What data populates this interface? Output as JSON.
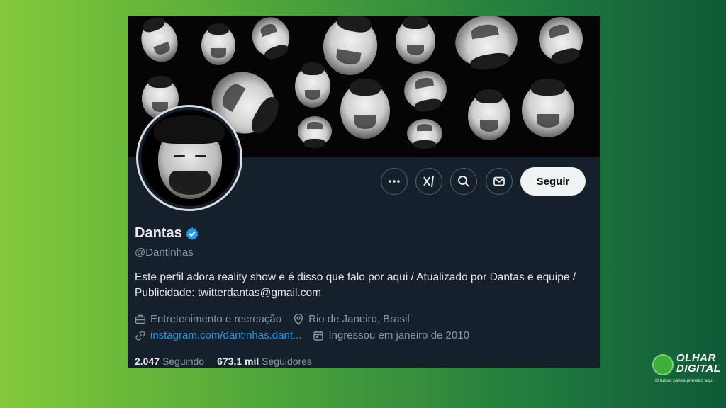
{
  "profile": {
    "name": "Dantas",
    "handle": "@Dantinhas",
    "bio": "Este perfil adora reality show e é disso que falo por aqui / Atualizado por Dantas e equipe / Publicidade: twitterdantas@gmail.com",
    "category": "Entretenimento e recreação",
    "location": "Rio de Janeiro, Brasil",
    "website": "instagram.com/dantinhas.dant...",
    "joined": "Ingressou em janeiro de 2010",
    "following_count": "2.047",
    "following_label": "Seguindo",
    "followers_count": "673,1 mil",
    "followers_label": "Seguidores"
  },
  "actions": {
    "more": "more-icon",
    "grok": "grok-icon",
    "search": "search-icon",
    "message": "mail-icon",
    "follow_label": "Seguir"
  },
  "watermark": {
    "line1": "OLHAR",
    "line2": "DIGITAL",
    "tagline": "O futuro passa primeiro aqui"
  },
  "colors": {
    "verified": "#1d9bf0",
    "link": "#1d9bf0",
    "background": "#15202b"
  }
}
